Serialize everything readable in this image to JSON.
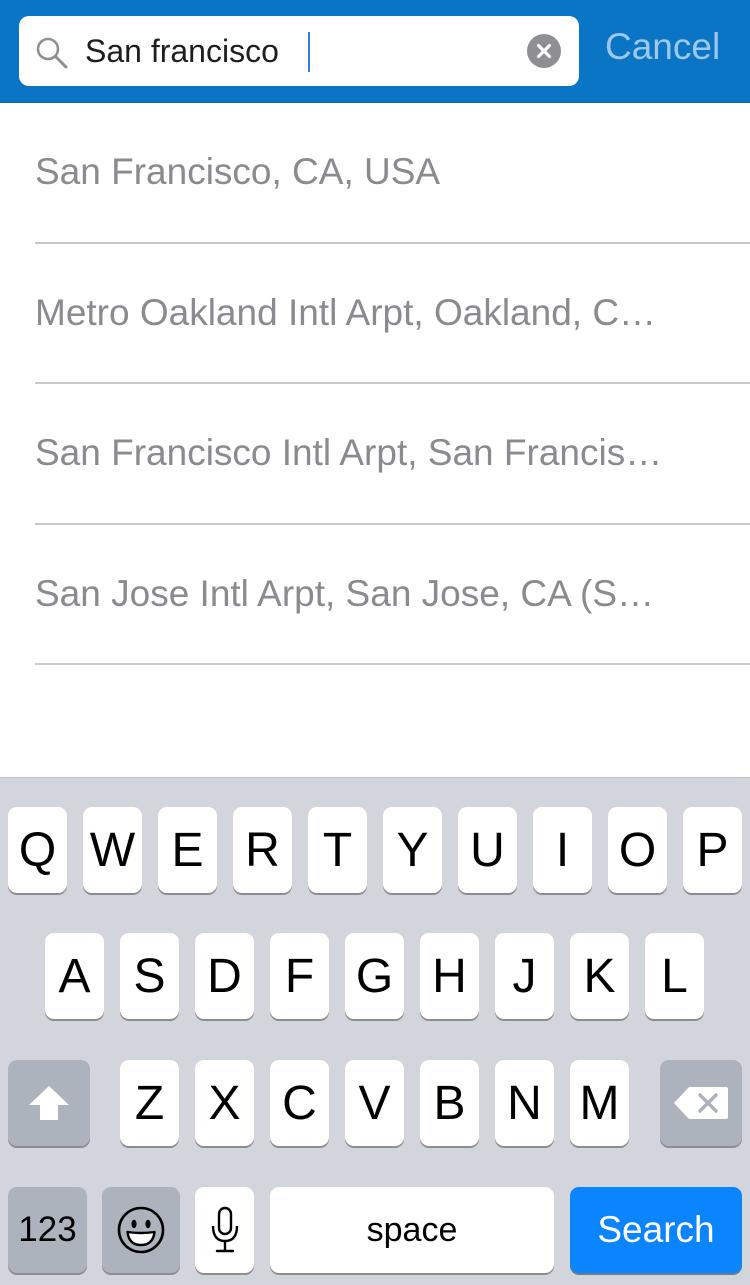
{
  "search": {
    "query": "San francisco",
    "cancel_label": "Cancel"
  },
  "results": [
    "San Francisco, CA, USA",
    "Metro Oakland Intl Arpt, Oakland, C…",
    "San Francisco Intl Arpt, San Francis…",
    "San Jose Intl Arpt, San Jose, CA (S…"
  ],
  "keyboard": {
    "row1": [
      "Q",
      "W",
      "E",
      "R",
      "T",
      "Y",
      "U",
      "I",
      "O",
      "P"
    ],
    "row2": [
      "A",
      "S",
      "D",
      "F",
      "G",
      "H",
      "J",
      "K",
      "L"
    ],
    "row3": [
      "Z",
      "X",
      "C",
      "V",
      "B",
      "N",
      "M"
    ],
    "shift_icon": "shift-arrow-icon",
    "delete_icon": "backspace-icon",
    "numbers_label": "123",
    "emoji_icon": "emoji-smiley-icon",
    "mic_icon": "microphone-icon",
    "space_label": "space",
    "search_label": "Search"
  },
  "colors": {
    "topbar": "#0a74c5",
    "cancel_text": "#9dc7ec",
    "result_text": "#8a8a8f",
    "keyboard_bg": "#d2d5db",
    "search_key": "#0b84ff"
  }
}
